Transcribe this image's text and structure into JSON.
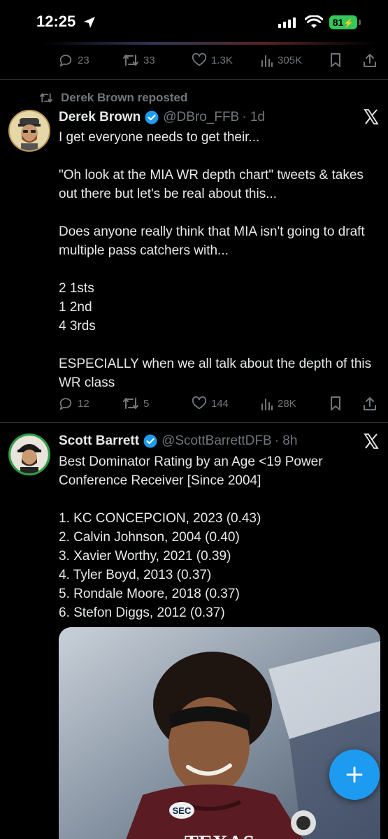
{
  "status_bar": {
    "time": "12:25",
    "battery": "81"
  },
  "prev_tweet_actions": {
    "replies": "23",
    "reposts": "33",
    "likes": "1.3K",
    "views": "305K"
  },
  "tweet1": {
    "repost_label": "Derek Brown reposted",
    "name": "Derek Brown",
    "handle": "@DBro_FFB",
    "time": "· 1d",
    "text": "I get everyone needs to get their...\n\n\"Oh look at the MIA WR depth chart\" tweets & takes out there but let's be real about this...\n\nDoes anyone really think that MIA isn't going to draft multiple pass catchers with...\n\n2 1sts\n1 2nd\n4 3rds\n\nESPECIALLY when we all talk about the depth of this WR class",
    "replies": "12",
    "reposts": "5",
    "likes": "144",
    "views": "28K"
  },
  "tweet2": {
    "name": "Scott Barrett",
    "handle": "@ScottBarrettDFB",
    "time": "· 8h",
    "text": "Best Dominator Rating by an Age <19 Power Conference Receiver [Since 2004]\n\n1. KC CONCEPCION, 2023 (0.43)\n2. Calvin Johnson, 2004 (0.40)\n3. Xavier Worthy, 2021 (0.39)\n4. Tyler Boyd, 2013 (0.37)\n5. Rondale Moore, 2018 (0.37)\n6. Stefon Diggs, 2012 (0.37)",
    "media_badge": "SEC",
    "media_jersey": "TEXAS"
  },
  "colors": {
    "background": "#000000",
    "text": "#e7e9ea",
    "muted": "#71767b",
    "accent": "#1d9bf0",
    "battery": "#34c759"
  },
  "icons": [
    "location-arrow-icon",
    "signal-icon",
    "wifi-icon",
    "reply-icon",
    "repost-icon",
    "like-icon",
    "views-icon",
    "bookmark-icon",
    "share-icon",
    "verified-icon",
    "x-logo-icon",
    "compose-plus-icon"
  ]
}
